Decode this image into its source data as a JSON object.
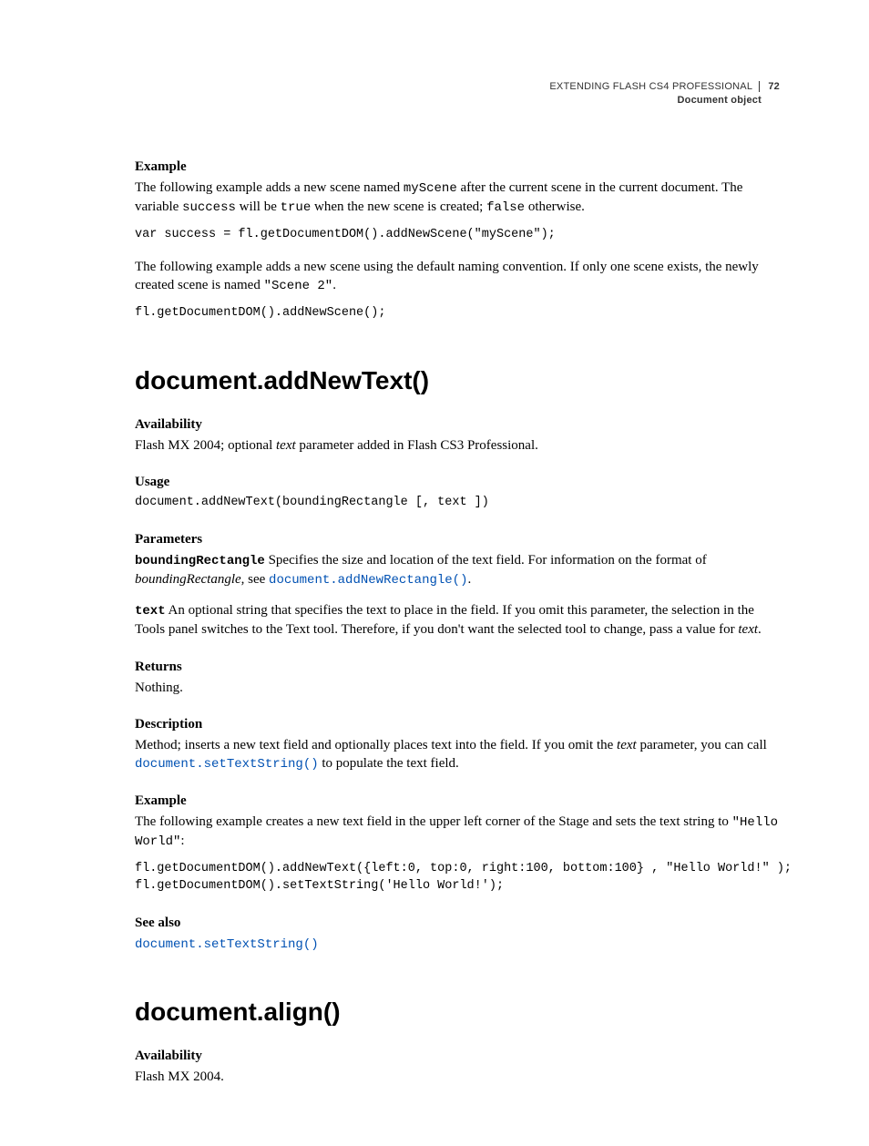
{
  "header": {
    "running_title": "EXTENDING FLASH CS4 PROFESSIONAL",
    "page_number": "72",
    "section": "Document object"
  },
  "section1": {
    "h_example": "Example",
    "p1_a": "The following example adds a new scene named ",
    "p1_code1": "myScene",
    "p1_b": " after the current scene in the current document. The variable ",
    "p1_code2": "success",
    "p1_c": " will be ",
    "p1_code3": "true",
    "p1_d": " when the new scene is created; ",
    "p1_code4": "false",
    "p1_e": " otherwise.",
    "code1": "var success = fl.getDocumentDOM().addNewScene(\"myScene\");",
    "p2_a": "The following example adds a new scene using the default naming convention. If only one scene exists, the newly created scene is named ",
    "p2_code1": "\"Scene 2\"",
    "p2_b": ".",
    "code2": "fl.getDocumentDOM().addNewScene();"
  },
  "method1": {
    "title": "document.addNewText()",
    "h_avail": "Availability",
    "avail_a": "Flash MX 2004; optional ",
    "avail_it": "text",
    "avail_b": " parameter added in Flash CS3 Professional.",
    "h_usage": "Usage",
    "usage_code": "document.addNewText(boundingRectangle [, text ])",
    "h_params": "Parameters",
    "param1_name": "boundingRectangle",
    "param1_a": "  Specifies the size and location of the text field. For information on the format of ",
    "param1_it": "boundingRectangle",
    "param1_b": ", see ",
    "param1_link": "document.addNewRectangle()",
    "param1_c": ".",
    "param2_name": "text",
    "param2_a": "  An optional string that specifies the text to place in the field. If you omit this parameter, the selection in the Tools panel switches to the Text tool. Therefore, if you don't want the selected tool to change, pass a value for ",
    "param2_it": "text",
    "param2_b": ".",
    "h_returns": "Returns",
    "returns": "Nothing.",
    "h_desc": "Description",
    "desc_a": "Method; inserts a new text field and optionally places text into the field. If you omit the ",
    "desc_it": "text",
    "desc_b": " parameter, you can call ",
    "desc_link": "document.setTextString()",
    "desc_c": " to populate the text field.",
    "h_example": "Example",
    "ex_a": "The following example creates a new text field in the upper left corner of the Stage and sets the text string to ",
    "ex_code1": "\"Hello World\"",
    "ex_b": ":",
    "ex_codeblock": "fl.getDocumentDOM().addNewText({left:0, top:0, right:100, bottom:100} , \"Hello World!\" );\nfl.getDocumentDOM().setTextString('Hello World!');",
    "h_seealso": "See also",
    "seealso_link": "document.setTextString()"
  },
  "method2": {
    "title": "document.align()",
    "h_avail": "Availability",
    "avail": "Flash MX 2004."
  }
}
